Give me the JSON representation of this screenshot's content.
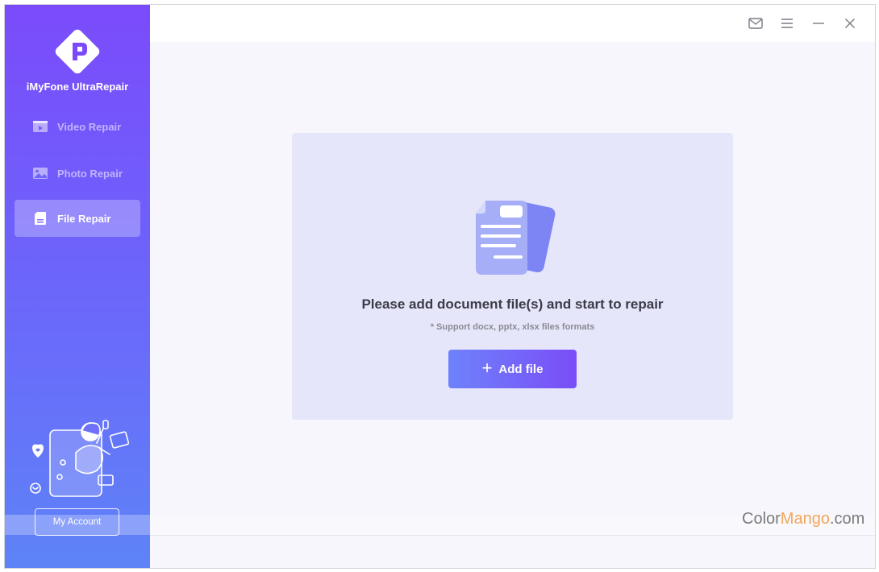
{
  "app": {
    "name": "iMyFone UltraRepair"
  },
  "sidebar": {
    "items": [
      {
        "label": "Video Repair",
        "icon": "video-icon",
        "active": false
      },
      {
        "label": "Photo Repair",
        "icon": "photo-icon",
        "active": false
      },
      {
        "label": "File Repair",
        "icon": "file-icon",
        "active": true
      }
    ],
    "account_label": "My Account"
  },
  "titlebar": {
    "icons": [
      "mail-icon",
      "menu-icon",
      "minimize-icon",
      "close-icon"
    ]
  },
  "main": {
    "prompt_title": "Please add document file(s) and start to repair",
    "prompt_sub": "* Support docx, pptx, xlsx files formats",
    "add_button": {
      "plus": "+",
      "label": "Add file"
    }
  },
  "watermark": {
    "part1": "Color",
    "part2": "Mango",
    "part3": ".com"
  },
  "colors": {
    "sidebar_top": "#7b4bfb",
    "sidebar_bottom": "#5e83f7",
    "button_start": "#6e82fb",
    "button_end": "#7a4df8",
    "panel_bg": "#e6e6fa",
    "main_bg": "#f6f6fc"
  }
}
